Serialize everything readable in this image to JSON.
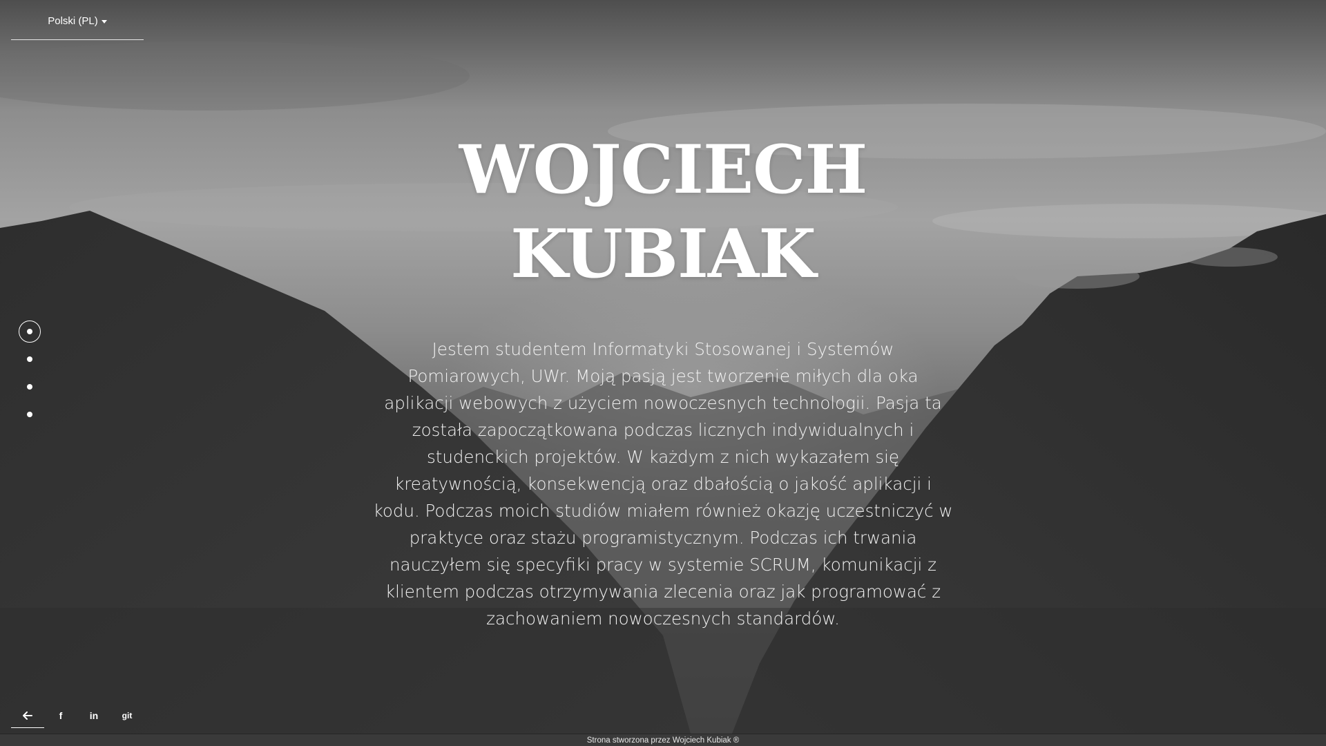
{
  "language_selector": {
    "label": "Polski (PL)"
  },
  "section_nav": {
    "count": 4,
    "active_index": 0
  },
  "hero": {
    "name_line1": "WOJCIECH",
    "name_line2": "KUBIAK",
    "bio": "Jestem studentem Informatyki Stosowanej i Systemów Pomiarowych, UWr. Moją pasją jest tworzenie miłych dla oka aplikacji webowych z użyciem nowoczesnych technologii. Pasja ta została zapoczątkowana podczas licznych indywidualnych i studenckich projektów. W każdym z nich wykazałem się kreatywnością, konsekwencją oraz dbałością o jakość aplikacji i kodu. Podczas moich studiów miałem również okazję uczestniczyć w praktyce oraz stażu programistycznym. Podczas ich trwania nauczyłem się specyfiki pracy w systemie SCRUM, komunikacji z klientem podczas otrzymywania zlecenia oraz jak programować z zachowaniem nowoczesnych standardów."
  },
  "social": {
    "back_icon": "arrow-left-icon",
    "facebook": "f",
    "linkedin": "in",
    "git": "git"
  },
  "footer": {
    "text": "Strona stworzona przez Wojciech Kubiak ®"
  }
}
